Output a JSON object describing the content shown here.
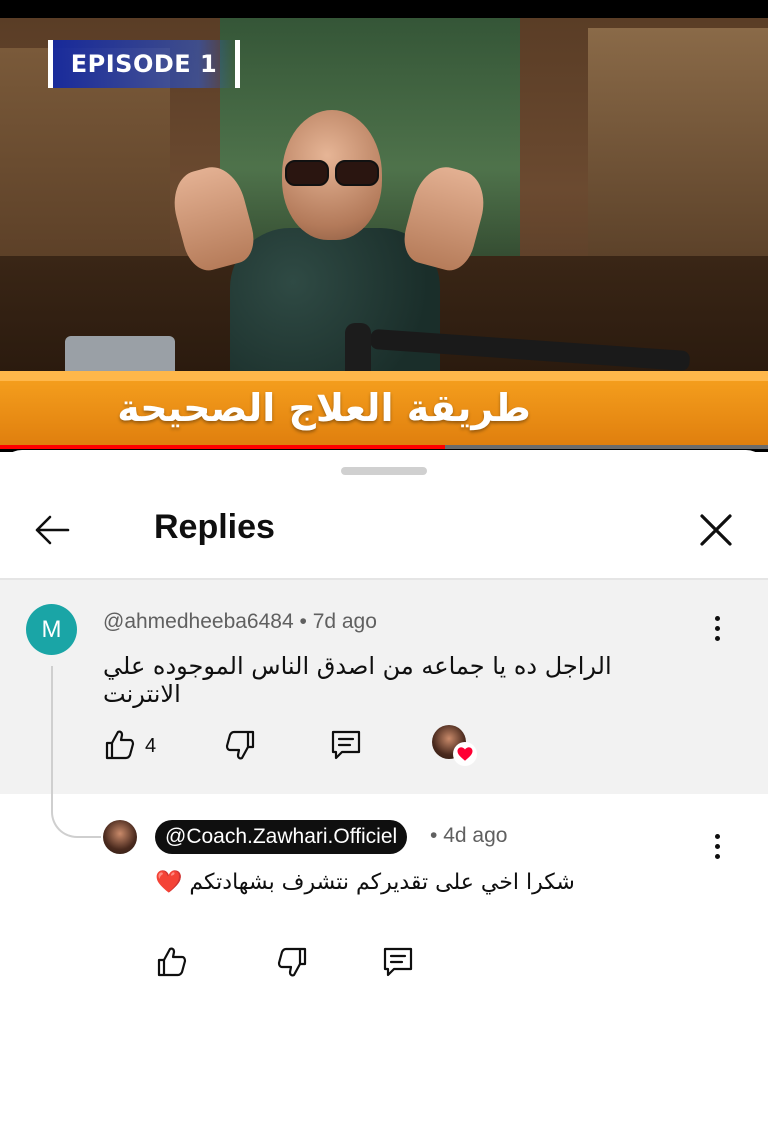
{
  "video": {
    "episode_badge": "EPISODE 1",
    "banner_text": "طريقة العلاج الصحيحة",
    "progress_fraction": 0.58
  },
  "sheet": {
    "title": "Replies",
    "back_icon": "arrow-left-icon",
    "close_icon": "close-icon"
  },
  "parent_comment": {
    "avatar_letter": "M",
    "avatar_color": "#1aa5a6",
    "author": "@ahmedheeba6484",
    "separator": "•",
    "time": "7d ago",
    "text": "الراجل ده يا جماعه من اصدق الناس الموجوده علي الانترنت",
    "like_count": "4",
    "creator_hearted": true
  },
  "reply_comment": {
    "author": "@Coach.Zawhari.Officiel",
    "separator": "•",
    "time": "4d ago",
    "text": "شكرا اخي على تقديركم نتشرف بشهادتكم ❤️"
  },
  "colors": {
    "accent_red": "#ff0000",
    "banner_orange": "#f29417",
    "heart_red": "#ff0033"
  }
}
